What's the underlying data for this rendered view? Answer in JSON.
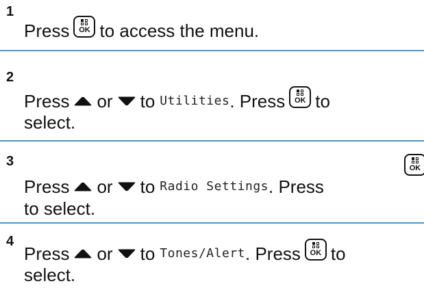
{
  "steps": [
    {
      "number": "1",
      "lines": [
        {
          "before": "Press",
          "key": "OK",
          "after": "to access the menu."
        }
      ]
    },
    {
      "number": "2",
      "lines": [
        {
          "press": "Press",
          "or": "or",
          "to": "to",
          "item": "Utilities",
          "press2": ". Press",
          "key": "OK",
          "tail": "to"
        },
        {
          "text": "select."
        }
      ]
    },
    {
      "number": "3",
      "lines": [
        {
          "press": "Press",
          "or": "or",
          "to": "to",
          "item": "Radio Settings",
          "press2": ". Press",
          "key": "OK"
        },
        {
          "text": "to select."
        }
      ]
    },
    {
      "number": "4",
      "lines": [
        {
          "press": "Press",
          "or": "or",
          "to": "to",
          "item": "Tones/Alert",
          "press2": ". Press",
          "key": "OK",
          "tail": "to"
        },
        {
          "text": "select."
        }
      ]
    }
  ],
  "key_label": "OK",
  "icons": {
    "menu_ok_key": "menu-ok-key-icon",
    "up": "up-arrow-icon",
    "down": "down-arrow-icon"
  },
  "colors": {
    "divider": "#4b97c8",
    "text": "#111111"
  }
}
